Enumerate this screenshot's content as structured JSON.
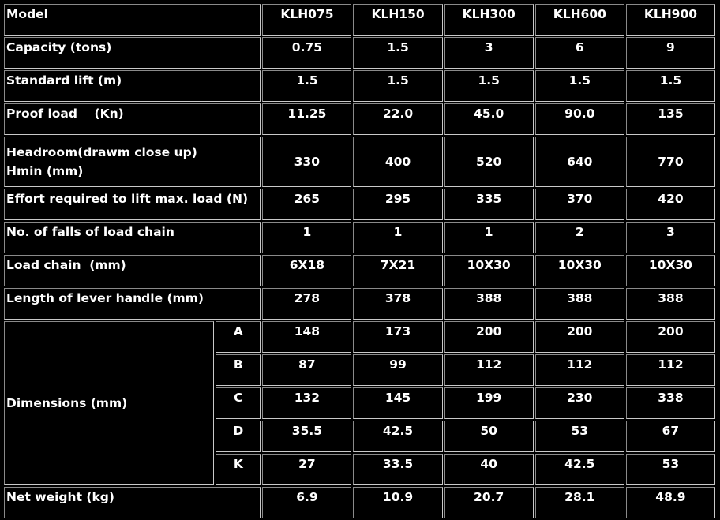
{
  "table": {
    "header": {
      "label": "Model",
      "models": [
        "KLH075",
        "KLH150",
        "KLH300",
        "KLH600",
        "KLH900"
      ]
    },
    "rows": [
      {
        "label": "Capacity (tons)",
        "values": [
          "0.75",
          "1.5",
          "3",
          "6",
          "9"
        ]
      },
      {
        "label": "Standard lift (m)",
        "values": [
          "1.5",
          "1.5",
          "1.5",
          "1.5",
          "1.5"
        ]
      },
      {
        "label": "Proof load    (Kn)",
        "values": [
          "11.25",
          "22.0",
          "45.0",
          "90.0",
          "135"
        ]
      },
      {
        "label": "Headroom(drawm close up) Hmin (mm)",
        "values": [
          "330",
          "400",
          "520",
          "640",
          "770"
        ]
      },
      {
        "label": "Effort required to lift max. load (N)",
        "values": [
          "265",
          "295",
          "335",
          "370",
          "420"
        ]
      },
      {
        "label": "No. of falls of load chain",
        "values": [
          "1",
          "1",
          "1",
          "2",
          "3"
        ]
      },
      {
        "label": "Load chain  (mm)",
        "values": [
          "6X18",
          "7X21",
          "10X30",
          "10X30",
          "10X30"
        ]
      },
      {
        "label": "Length of lever handle (mm)",
        "values": [
          "278",
          "378",
          "388",
          "388",
          "388"
        ]
      }
    ],
    "dimensions": {
      "label": "Dimensions (mm)",
      "rows": [
        {
          "key": "A",
          "values": [
            "148",
            "173",
            "200",
            "200",
            "200"
          ]
        },
        {
          "key": "B",
          "values": [
            "87",
            "99",
            "112",
            "112",
            "112"
          ]
        },
        {
          "key": "C",
          "values": [
            "132",
            "145",
            "199",
            "230",
            "338"
          ]
        },
        {
          "key": "D",
          "values": [
            "35.5",
            "42.5",
            "50",
            "53",
            "67"
          ]
        },
        {
          "key": "K",
          "values": [
            "27",
            "33.5",
            "40",
            "42.5",
            "53"
          ]
        }
      ]
    },
    "net_weight": {
      "label": "Net weight (kg)",
      "values": [
        "6.9",
        "10.9",
        "20.7",
        "28.1",
        "48.9"
      ]
    }
  }
}
